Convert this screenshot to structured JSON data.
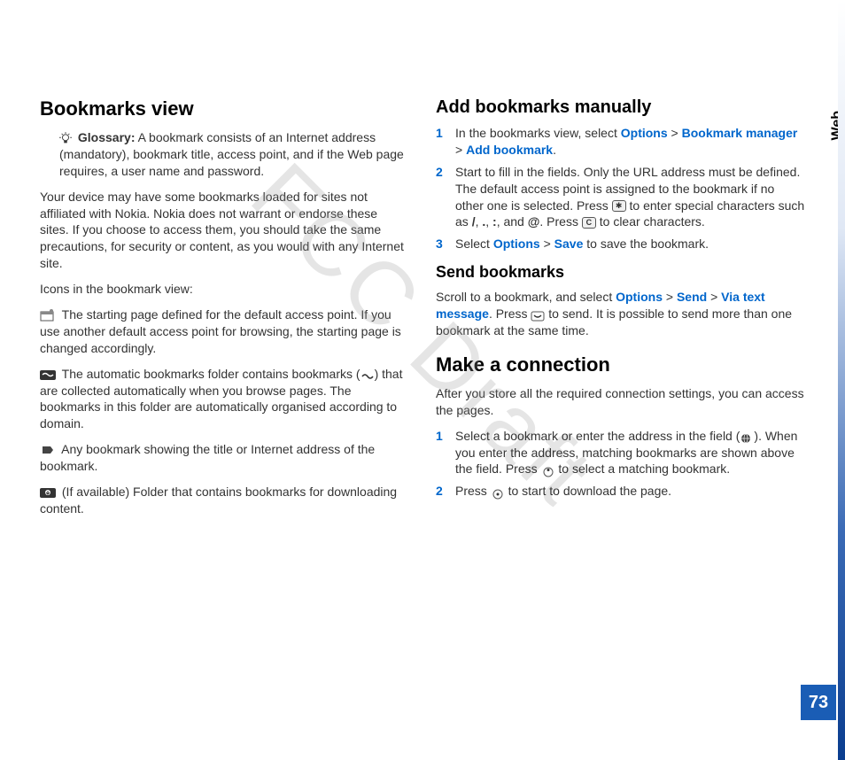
{
  "watermark": "FCC Draft",
  "sideTab": "Web",
  "pageNumber": "73",
  "left": {
    "heading": "Bookmarks view",
    "glossaryLabel": "Glossary:",
    "glossaryText": " A bookmark consists of an Internet address (mandatory), bookmark title, access point, and if the Web page requires, a user name and password.",
    "p1": "Your device may have some bookmarks loaded for sites not affiliated with Nokia. Nokia does not warrant or endorse these sites. If you choose to access them, you should take the same precautions, for security or content, as you would with any Internet site.",
    "p2": "Icons in the bookmark view:",
    "p3": " The starting page defined for the default access point. If you use another default access point for browsing, the starting page is changed accordingly.",
    "p4a": " The automatic bookmarks folder contains bookmarks (",
    "p4b": ") that are collected automatically when you browse pages. The bookmarks in this folder are automatically organised according to domain.",
    "p5": " Any bookmark showing the title or Internet address of the bookmark.",
    "p6": " (If available) Folder that contains bookmarks for downloading content."
  },
  "right": {
    "heading1": "Add bookmarks manually",
    "item1a": "In the bookmarks view, select ",
    "cmdOptions": "Options",
    "gt": " > ",
    "cmdBookmarkManager": "Bookmark manager",
    "cmdAddBookmark": "Add bookmark",
    "dot": ".",
    "item2a": "Start to fill in the fields. Only the URL address must be defined. The default access point is assigned to the bookmark if no other one is selected. Press ",
    "item2b": " to enter special characters such as ",
    "chars1": "/",
    "chars2": ".",
    "chars3": ":",
    "chars4": "@",
    "comma": ", ",
    "and": ", and ",
    "pressText": ". Press ",
    "item2c": " to clear characters.",
    "item3a": "Select ",
    "cmdSave": "Save",
    "item3b": " to save the bookmark.",
    "heading2": "Send bookmarks",
    "send1": "Scroll to a bookmark, and select ",
    "cmdSend": "Send",
    "cmdViaText": "Via text message",
    "send2": ". Press ",
    "send3": " to send. It is possible to send more than one bookmark at the same time.",
    "heading3": "Make a connection",
    "conn1": "After you store all the required connection settings, you can access the pages.",
    "connItem1a": "Select a bookmark or enter the address in the field (",
    "connItem1b": "). When you enter the address, matching bookmarks are shown above the field. Press ",
    "connItem1c": " to select a matching bookmark.",
    "connItem2a": "Press ",
    "connItem2b": " to start to download the page."
  }
}
